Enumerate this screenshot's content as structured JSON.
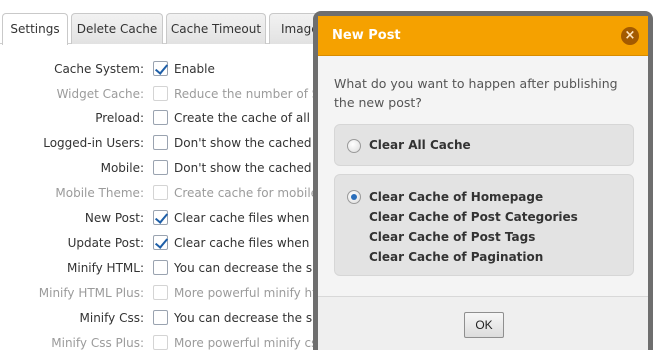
{
  "tabs": [
    {
      "label": "Settings",
      "active": true
    },
    {
      "label": "Delete Cache",
      "active": false
    },
    {
      "label": "Cache Timeout",
      "active": false
    },
    {
      "label": "Image",
      "active": false
    }
  ],
  "settings": [
    {
      "label": "Cache System:",
      "checked": true,
      "disabled": false,
      "description": "Enable"
    },
    {
      "label": "Widget Cache:",
      "checked": false,
      "disabled": true,
      "description": "Reduce the number of SQL"
    },
    {
      "label": "Preload:",
      "checked": false,
      "disabled": false,
      "description": "Create the cache of all the s"
    },
    {
      "label": "Logged-in Users:",
      "checked": false,
      "disabled": false,
      "description": "Don't show the cached vers"
    },
    {
      "label": "Mobile:",
      "checked": false,
      "disabled": false,
      "description": "Don't show the cached vers"
    },
    {
      "label": "Mobile Theme:",
      "checked": false,
      "disabled": true,
      "description": "Create cache for mobile the"
    },
    {
      "label": "New Post:",
      "checked": true,
      "disabled": false,
      "description": "Clear cache files when a po"
    },
    {
      "label": "Update Post:",
      "checked": true,
      "disabled": false,
      "description": "Clear cache files when a po"
    },
    {
      "label": "Minify HTML:",
      "checked": false,
      "disabled": false,
      "description": "You can decrease the size o"
    },
    {
      "label": "Minify HTML Plus:",
      "checked": false,
      "disabled": true,
      "description": "More powerful minify html"
    },
    {
      "label": "Minify Css:",
      "checked": false,
      "disabled": false,
      "description": "You can decrease the size o"
    },
    {
      "label": "Minify Css Plus:",
      "checked": false,
      "disabled": true,
      "description": "More powerful minify css"
    }
  ],
  "dialog": {
    "title": "New Post",
    "close_icon": "close-icon",
    "question": "What do you want to happen after publishing the new post?",
    "options": [
      {
        "lines": [
          "Clear All Cache"
        ],
        "selected": false
      },
      {
        "lines": [
          "Clear Cache of Homepage",
          "Clear Cache of Post Categories",
          "Clear Cache of Post Tags",
          "Clear Cache of Pagination"
        ],
        "selected": true
      }
    ],
    "ok_label": "OK"
  },
  "colors": {
    "header": "#f5a100",
    "overlay": "#6e6e6e",
    "checkmark": "#1e5fa8",
    "radio_selected": "#2a6ebb"
  }
}
